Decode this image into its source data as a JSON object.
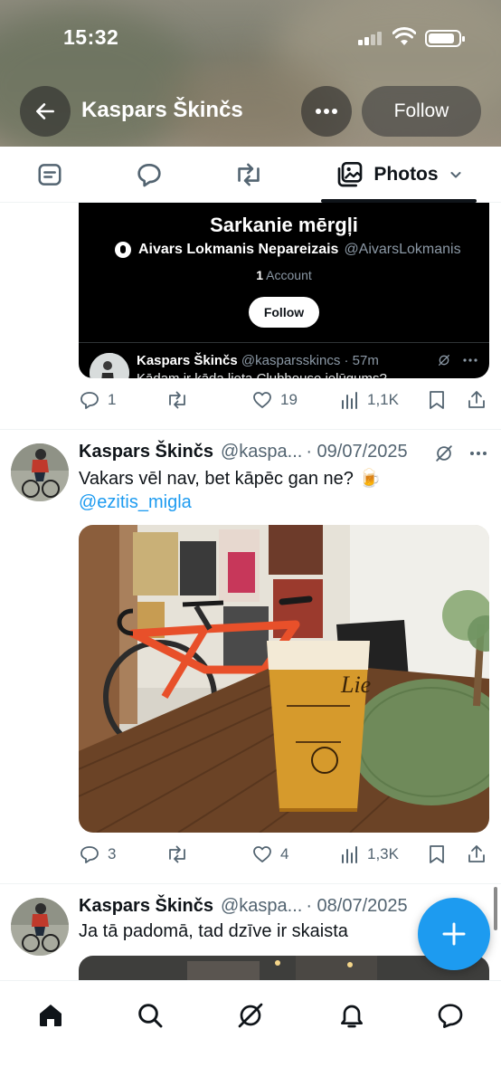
{
  "status": {
    "time": "15:32"
  },
  "header": {
    "name": "Kaspars Škinčs",
    "follow_label": "Follow"
  },
  "tabs": {
    "active_label": "Photos"
  },
  "list_card": {
    "title": "Sarkanie mērgļi",
    "owner_name": "Aivars Lokmanis Nepareizais",
    "owner_handle": "@AivarsLokmanis",
    "count": "1",
    "count_label": "Account",
    "follow_label": "Follow",
    "nested_name": "Kaspars Škinčs",
    "nested_handle": "@kasparsskincs · 57m",
    "nested_text": "Kādam ir kāda lieta Clubhouse ielūgums?"
  },
  "post0_actions": {
    "replies": "1",
    "likes": "19",
    "views": "1,1K"
  },
  "posts": [
    {
      "name": "Kaspars Škinčs",
      "handle": "@kaspa...",
      "date": "· 09/07/2025",
      "text": "Vakars vēl nav, bet kāpēc gan ne? 🍺",
      "mention": "@ezitis_migla",
      "replies": "3",
      "likes": "4",
      "views": "1,3K"
    },
    {
      "name": "Kaspars Škinčs",
      "handle": "@kaspa...",
      "date": "· 08/07/2025",
      "text": "Ja tā padomā, tad dzīve ir skaista"
    }
  ],
  "colors": {
    "accent": "#1d9bf0",
    "text": "#0f1419",
    "muted": "#536471"
  },
  "icons": [
    "back-arrow-icon",
    "more-icon",
    "posts-icon",
    "replies-icon",
    "reposts-icon",
    "photos-icon",
    "chevron-down-icon",
    "reply-icon",
    "repost-icon",
    "like-icon",
    "views-icon",
    "bookmark-icon",
    "share-icon",
    "grok-icon",
    "home-icon",
    "search-icon",
    "bell-icon",
    "messages-icon",
    "plus-icon"
  ]
}
